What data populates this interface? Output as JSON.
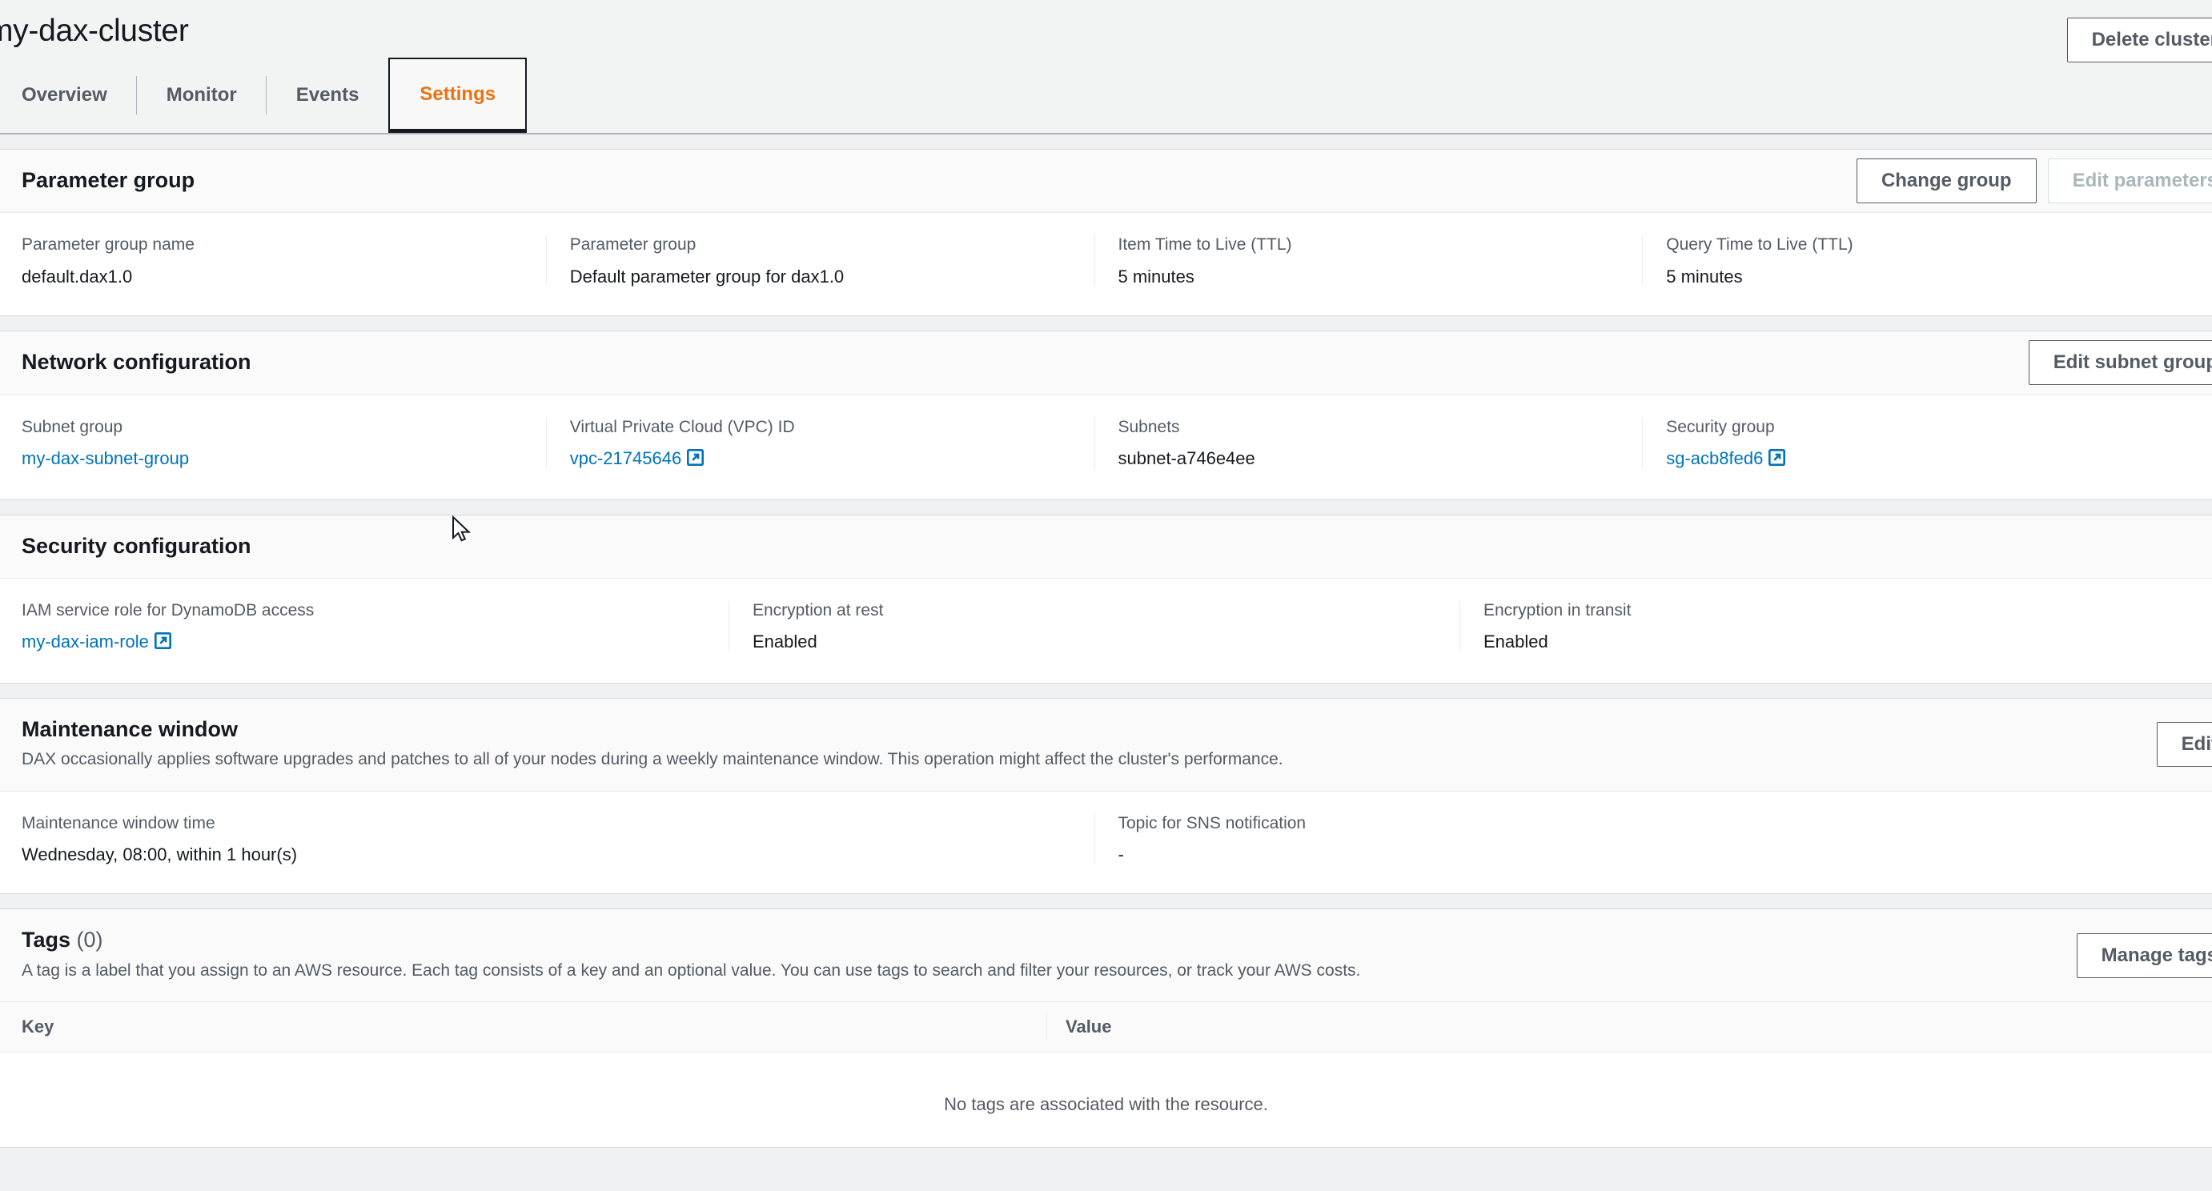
{
  "header": {
    "cluster_name": "my-dax-cluster",
    "delete_button": "Delete cluster",
    "tabs": [
      {
        "label": "Overview",
        "active": false
      },
      {
        "label": "Monitor",
        "active": false
      },
      {
        "label": "Events",
        "active": false
      },
      {
        "label": "Settings",
        "active": true
      }
    ]
  },
  "parameter_group": {
    "title": "Parameter group",
    "change_group_button": "Change group",
    "edit_parameters_button": "Edit parameters",
    "fields": [
      {
        "label": "Parameter group name",
        "value": "default.dax1.0"
      },
      {
        "label": "Parameter group",
        "value": "Default parameter group for dax1.0"
      },
      {
        "label": "Item Time to Live (TTL)",
        "value": "5 minutes"
      },
      {
        "label": "Query Time to Live (TTL)",
        "value": "5 minutes"
      }
    ]
  },
  "network_configuration": {
    "title": "Network configuration",
    "edit_subnet_group_button": "Edit subnet group",
    "fields": [
      {
        "label": "Subnet group",
        "value": "my-dax-subnet-group",
        "link": true,
        "external": false
      },
      {
        "label": "Virtual Private Cloud (VPC) ID",
        "value": "vpc-21745646",
        "link": true,
        "external": true
      },
      {
        "label": "Subnets",
        "value": "subnet-a746e4ee",
        "link": false,
        "external": false
      },
      {
        "label": "Security group",
        "value": "sg-acb8fed6",
        "link": true,
        "external": true
      }
    ]
  },
  "security_configuration": {
    "title": "Security configuration",
    "fields": [
      {
        "label": "IAM service role for DynamoDB access",
        "value": "my-dax-iam-role",
        "link": true,
        "external": true
      },
      {
        "label": "Encryption at rest",
        "value": "Enabled",
        "link": false,
        "external": false
      },
      {
        "label": "Encryption in transit",
        "value": "Enabled",
        "link": false,
        "external": false
      }
    ]
  },
  "maintenance_window": {
    "title": "Maintenance window",
    "description": "DAX occasionally applies software upgrades and patches to all of your nodes during a weekly maintenance window. This operation might affect the cluster's performance.",
    "edit_button": "Edit",
    "fields": [
      {
        "label": "Maintenance window time",
        "value": "Wednesday, 08:00, within 1 hour(s)"
      },
      {
        "label": "Topic for SNS notification",
        "value": "-"
      }
    ]
  },
  "tags": {
    "title": "Tags",
    "count": "(0)",
    "description": "A tag is a label that you assign to an AWS resource. Each tag consists of a key and an optional value. You can use tags to search and filter your resources, or track your AWS costs.",
    "manage_tags_button": "Manage tags",
    "columns": [
      "Key",
      "Value"
    ],
    "empty_message": "No tags are associated with the resource.",
    "rows": []
  },
  "colors": {
    "accent_orange": "#ec7211",
    "link_blue": "#0073bb",
    "text_primary": "#16191f",
    "text_secondary": "#545b64",
    "page_bg": "#eff1f2"
  },
  "icons": {
    "external_link": "external-link-icon",
    "cursor": "mouse-pointer-icon"
  }
}
